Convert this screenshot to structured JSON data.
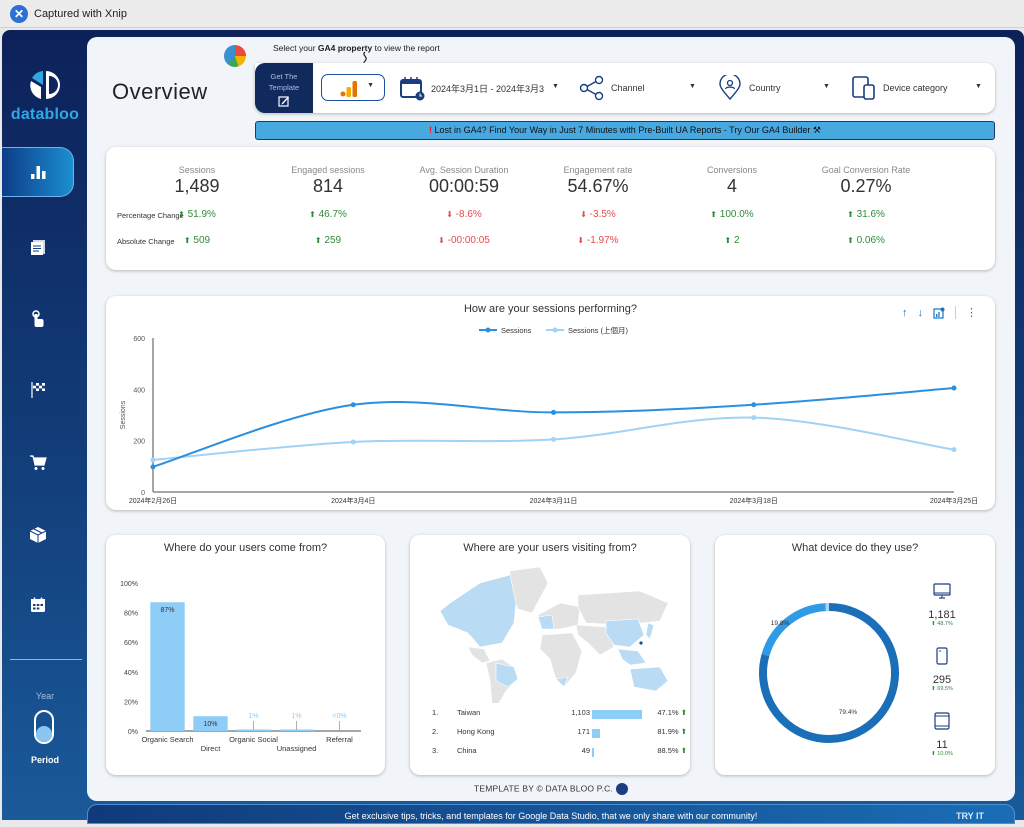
{
  "window": {
    "title": "Captured with Xnip"
  },
  "brand": {
    "name": "databloo"
  },
  "sidebar": {
    "items": [
      {
        "name": "overview",
        "icon": "bar-chart-icon",
        "active": true
      },
      {
        "name": "pages",
        "icon": "document-icon",
        "active": false
      },
      {
        "name": "engagement",
        "icon": "touch-icon",
        "active": false
      },
      {
        "name": "conversions",
        "icon": "checkered-flag-icon",
        "active": false
      },
      {
        "name": "ecommerce",
        "icon": "cart-icon",
        "active": false
      },
      {
        "name": "products",
        "icon": "box-icon",
        "active": false
      },
      {
        "name": "calendar",
        "icon": "calendar-icon",
        "active": false
      }
    ],
    "toggle": {
      "top_label": "Year",
      "bottom_label": "Period",
      "state": "Period"
    }
  },
  "header": {
    "title": "Overview",
    "ga4_hint_prefix": "Select your ",
    "ga4_hint_bold": "GA4 property",
    "ga4_hint_suffix": " to view the report",
    "get_template_line1": "Get The",
    "get_template_line2": "Template",
    "filters": {
      "date_range": "2024年3月1日 - 2024年3月3",
      "channel": "Channel",
      "country": "Country",
      "device": "Device category"
    },
    "banner_text": "Lost in GA4? Find Your Way in Just 7 Minutes with Pre-Built UA Reports - Try Our GA4 Builder ⚒"
  },
  "kpis": {
    "row_labels": {
      "pct": "Percentage Change",
      "abs": "Absolute Change"
    },
    "items": [
      {
        "label": "Sessions",
        "value": "1,489",
        "pct": "51.9%",
        "pct_dir": "up",
        "abs": "509",
        "abs_dir": "up"
      },
      {
        "label": "Engaged sessions",
        "value": "814",
        "pct": "46.7%",
        "pct_dir": "up",
        "abs": "259",
        "abs_dir": "up"
      },
      {
        "label": "Avg. Session Duration",
        "value": "00:00:59",
        "pct": "-8.6%",
        "pct_dir": "down",
        "abs": "-00:00:05",
        "abs_dir": "down"
      },
      {
        "label": "Engagement rate",
        "value": "54.67%",
        "pct": "-3.5%",
        "pct_dir": "down",
        "abs": "-1.97%",
        "abs_dir": "down"
      },
      {
        "label": "Conversions",
        "value": "4",
        "pct": "100.0%",
        "pct_dir": "up",
        "abs": "2",
        "abs_dir": "up"
      },
      {
        "label": "Goal Conversion Rate",
        "value": "0.27%",
        "pct": "31.6%",
        "pct_dir": "up",
        "abs": "0.06%",
        "abs_dir": "up"
      }
    ]
  },
  "colors": {
    "series_current": "#2b8fe0",
    "series_previous": "#9fd3f7",
    "bar": "#8ecdf6",
    "donut_desktop": "#1a6fb8",
    "donut_mobile": "#2f9ae6",
    "donut_tablet": "#a9d7f5",
    "up": "#2e8b3a",
    "down": "#e84a4a"
  },
  "chart_data": [
    {
      "type": "line",
      "title": "How are your sessions performing?",
      "xlabel": "",
      "ylabel": "Sessions",
      "x": [
        "2024年2月26日",
        "2024年3月4日",
        "2024年3月11日",
        "2024年3月18日",
        "2024年3月25日"
      ],
      "ylim": [
        0,
        600
      ],
      "yticks": [
        0,
        200,
        400,
        600
      ],
      "legend": "top-center",
      "series": [
        {
          "name": "Sessions",
          "values": [
            98,
            340,
            310,
            340,
            405
          ]
        },
        {
          "name": "Sessions (上個月)",
          "values": [
            125,
            195,
            205,
            290,
            165
          ]
        }
      ]
    },
    {
      "type": "bar",
      "title": "Where do your users come from?",
      "categories": [
        "Organic Search",
        "Direct",
        "Organic Social",
        "Unassigned",
        "Referral"
      ],
      "values": [
        87,
        10,
        1,
        1,
        0
      ],
      "labels": [
        "87%",
        "10%",
        "1%",
        "1%",
        "<0%"
      ],
      "ylim": [
        0,
        100
      ],
      "yticks": [
        "0%",
        "20%",
        "40%",
        "60%",
        "80%",
        "100%"
      ]
    },
    {
      "type": "table",
      "title": "Where are your users visiting from?",
      "rows": [
        {
          "rank": "1.",
          "country": "Taiwan",
          "value": "1,103",
          "raw": 1103,
          "change": "47.1%"
        },
        {
          "rank": "2.",
          "country": "Hong Kong",
          "value": "171",
          "raw": 171,
          "change": "81.9%"
        },
        {
          "rank": "3.",
          "country": "China",
          "value": "49",
          "raw": 49,
          "change": "88.5%"
        }
      ],
      "highlighted_regions": [
        "North America",
        "Brazil",
        "Western Europe",
        "South Africa",
        "China",
        "Japan",
        "Taiwan",
        "Southeast Asia",
        "Australia"
      ]
    },
    {
      "type": "pie",
      "title": "What device do they use?",
      "slices": [
        {
          "name": "desktop",
          "value": 79.4,
          "label": "79.4%"
        },
        {
          "name": "mobile",
          "value": 19.8,
          "label": "19.8%"
        },
        {
          "name": "tablet",
          "value": 0.8,
          "label": ""
        }
      ]
    }
  ],
  "devices": [
    {
      "name": "desktop",
      "icon": "desktop-icon",
      "value": "1,181",
      "change": "48.7%"
    },
    {
      "name": "mobile",
      "icon": "mobile-icon",
      "value": "295",
      "change": "69.5%"
    },
    {
      "name": "tablet",
      "icon": "tablet-icon",
      "value": "11",
      "change": "10.0%"
    }
  ],
  "footer": {
    "credit": "TEMPLATE BY © DATA BLOO P.C.",
    "cta": "Get exclusive tips, tricks, and templates for Google Data Studio, that we only share with our community!",
    "try_label": "TRY IT"
  }
}
